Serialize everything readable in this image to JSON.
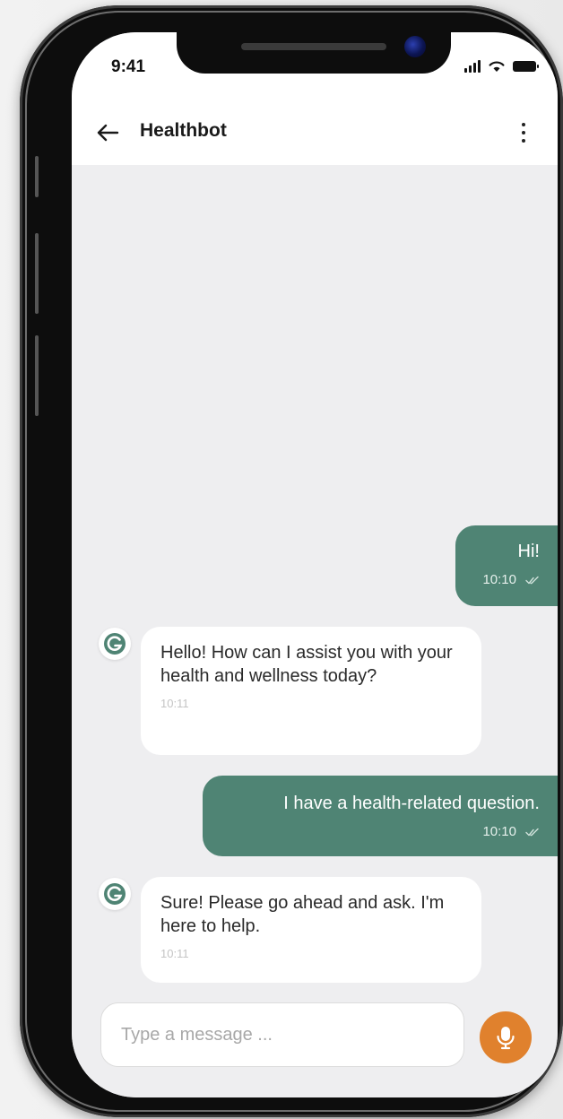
{
  "status_bar": {
    "time": "9:41",
    "icons": [
      "signal-icon",
      "wifi-icon",
      "battery-icon"
    ]
  },
  "header": {
    "back_icon": "arrow-left-icon",
    "title": "Healthbot",
    "menu_icon": "more-vertical-icon"
  },
  "messages": [
    {
      "from": "user",
      "text": "Hi!",
      "time": "10:10",
      "status_icon": "double-check-icon"
    },
    {
      "from": "bot",
      "text": "Hello! How can I assist you with your health and wellness today?",
      "time": "10:11"
    },
    {
      "from": "user",
      "text": "I have a health-related question.",
      "time": "10:10",
      "status_icon": "double-check-icon"
    },
    {
      "from": "bot",
      "text": "Sure! Please go ahead and ask. I'm here to help.",
      "time": "10:11"
    }
  ],
  "composer": {
    "placeholder": "Type a message ...",
    "value": "",
    "mic_icon": "microphone-icon"
  },
  "colors": {
    "user_bubble": "#4f8474",
    "bot_bubble": "#ffffff",
    "chat_background": "#eeeef0",
    "mic_button": "#e0812d"
  }
}
